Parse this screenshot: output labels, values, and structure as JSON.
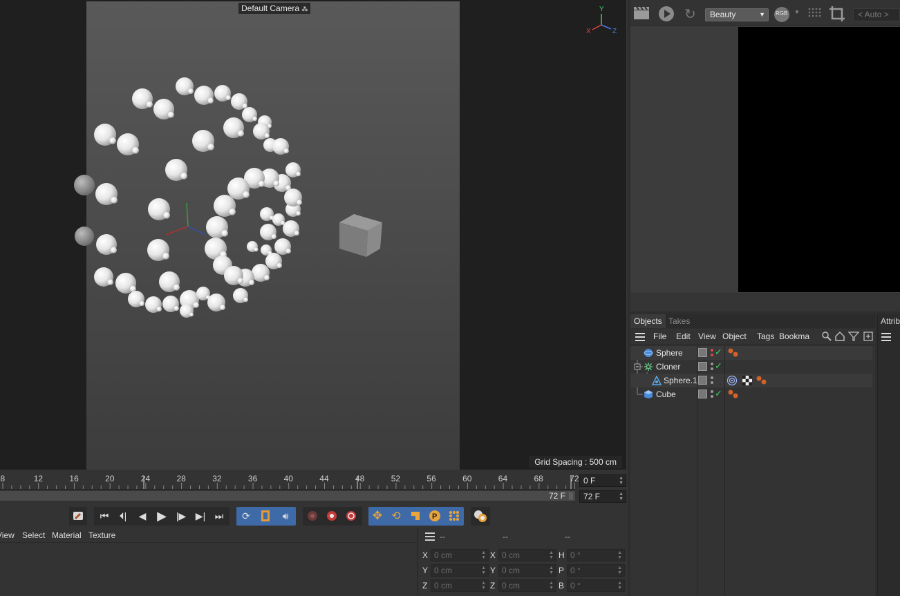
{
  "viewport": {
    "camera_label": "Default Camera",
    "grid_spacing": "Grid Spacing : 500 cm",
    "axis_labels": {
      "x": "X",
      "y": "Y",
      "z": "Z"
    }
  },
  "timeline": {
    "ticks": [
      "8",
      "12",
      "16",
      "20",
      "24",
      "28",
      "32",
      "36",
      "40",
      "44",
      "48",
      "52",
      "56",
      "60",
      "64",
      "68",
      "72"
    ],
    "frame_end_label": "72 F",
    "current_frame": "0 F",
    "end_frame": "72 F"
  },
  "transport": {
    "buttons": [
      "go-to-start",
      "previous-key",
      "previous-frame",
      "play",
      "next-frame",
      "next-key",
      "go-to-end",
      "loop",
      "film",
      "sound",
      "record-disabled",
      "autokey",
      "record",
      "move",
      "rotate",
      "scale",
      "param",
      "point-level",
      "motion-system"
    ]
  },
  "material_menu": [
    "View",
    "Select",
    "Material",
    "Texture"
  ],
  "coordinates": {
    "headers": [
      "--",
      "--",
      "--"
    ],
    "rows": [
      {
        "a": "X",
        "a_val": "0 cm",
        "b": "X",
        "b_val": "0 cm",
        "c": "H",
        "c_val": "0 °"
      },
      {
        "a": "Y",
        "a_val": "0 cm",
        "b": "Y",
        "b_val": "0 cm",
        "c": "P",
        "c_val": "0 °"
      },
      {
        "a": "Z",
        "a_val": "0 cm",
        "b": "Z",
        "b_val": "0 cm",
        "c": "B",
        "c_val": "0 °"
      }
    ]
  },
  "picture_viewer": {
    "render_pass": "Beauty",
    "rgb_label": "RGB",
    "auto_field": "< Auto >"
  },
  "object_manager": {
    "tabs": [
      "Objects",
      "Takes"
    ],
    "menu": [
      "File",
      "Edit",
      "View",
      "Object",
      "Tags",
      "Bookma"
    ],
    "objects": [
      {
        "name": "Sphere",
        "type": "sphere",
        "indent": 0
      },
      {
        "name": "Cloner",
        "type": "cloner",
        "indent": 0
      },
      {
        "name": "Sphere.1",
        "type": "mograph-child",
        "indent": 1
      },
      {
        "name": "Cube",
        "type": "cube",
        "indent": 0
      }
    ]
  },
  "attributes": {
    "tab": "Attrib"
  },
  "colors": {
    "accent_blue": "#3f6aa8",
    "check_green": "#3fcf5f",
    "tag_orange": "#d2622a"
  }
}
